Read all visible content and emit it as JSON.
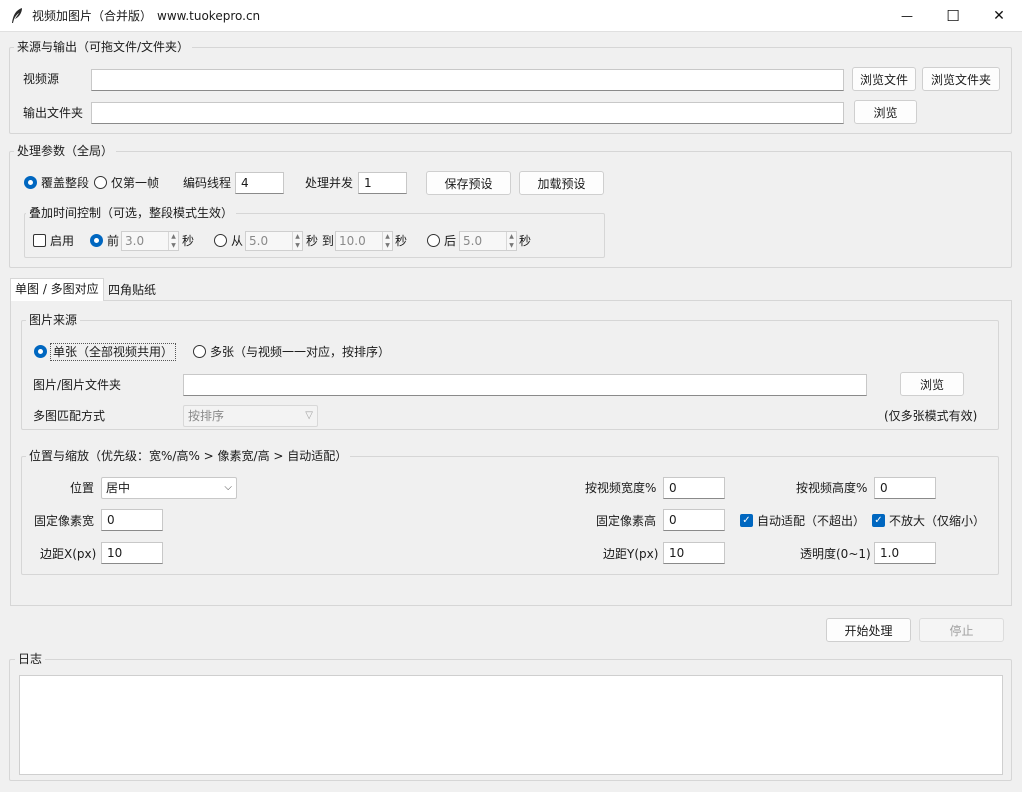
{
  "window": {
    "title": "视频加图片（合并版）",
    "url": "www.tuokepro.cn",
    "minimize": "—",
    "maximize": "☐",
    "close": "✕",
    "app_icon": "feather-icon"
  },
  "source_output": {
    "title": "来源与输出（可拖文件/文件夹）",
    "video_label": "视频源",
    "video_value": "",
    "browse_file": "浏览文件",
    "browse_folder": "浏览文件夹",
    "output_label": "输出文件夹",
    "output_value": "",
    "browse": "浏览"
  },
  "params": {
    "title": "处理参数（全局）",
    "mode_full": "覆盖整段",
    "mode_first": "仅第一帧",
    "threads_label": "编码线程",
    "threads_value": "4",
    "concurrency_label": "处理并发",
    "concurrency_value": "1",
    "save_preset": "保存预设",
    "load_preset": "加载预设",
    "timing": {
      "title": "叠加时间控制（可选，整段模式生效）",
      "enable": "启用",
      "before": "前",
      "before_value": "3.0",
      "sec": "秒",
      "from": "从",
      "from_value": "5.0",
      "to": "秒 到",
      "to_value": "10.0",
      "after": "后",
      "after_value": "5.0"
    }
  },
  "tabs": {
    "single_multi": "单图 / 多图对应",
    "corner": "四角贴纸"
  },
  "image_source": {
    "title": "图片来源",
    "single": "单张（全部视频共用）",
    "multi": "多张（与视频一一对应，按排序）",
    "path_label": "图片/图片文件夹",
    "path_value": "",
    "browse": "浏览",
    "match_label": "多图匹配方式",
    "match_value": "按排序",
    "note": "(仅多张模式有效)"
  },
  "position": {
    "title": "位置与缩放（优先级：宽%/高% > 像素宽/高 > 自动适配）",
    "pos_label": "位置",
    "pos_value": "居中",
    "width_pct_label": "按视频宽度%",
    "width_pct_value": "0",
    "height_pct_label": "按视频高度%",
    "height_pct_value": "0",
    "px_width_label": "固定像素宽",
    "px_width_value": "0",
    "px_height_label": "固定像素高",
    "px_height_value": "0",
    "auto_fit": "自动适配（不超出）",
    "no_enlarge": "不放大（仅缩小）",
    "margin_x_label": "边距X(px)",
    "margin_x_value": "10",
    "margin_y_label": "边距Y(px)",
    "margin_y_value": "10",
    "opacity_label": "透明度(0~1)",
    "opacity_value": "1.0"
  },
  "actions": {
    "start": "开始处理",
    "stop": "停止"
  },
  "log": {
    "title": "日志",
    "content": ""
  },
  "colors": {
    "accent": "#0067c0",
    "window_bg": "#f0f0f0",
    "field_bg": "#ffffff"
  }
}
